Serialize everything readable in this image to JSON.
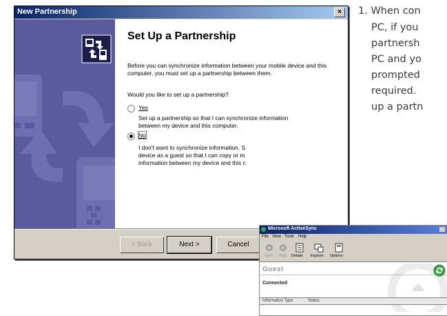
{
  "manual": {
    "lines": [
      "1. When con",
      "PC, if you",
      "partnersh",
      "PC and yo",
      "prompted",
      "required.",
      "up a partn"
    ]
  },
  "wizard": {
    "title": "New Partnership",
    "close_glyph": "×",
    "heading": "Set Up a Partnership",
    "intro": "Before you can synchronize information between your mobile device and this computer, you must set up a partnership between them.",
    "question": "Would you like to set up a partnership?",
    "yes_label": "Yes",
    "yes_desc": "Set up a partnership so that I can synchronize information between my device and this computer.",
    "no_label": "No",
    "no_desc_1": "I don't want to synchronize information. S",
    "no_desc_2": "device as a guest so that I can copy or m",
    "no_desc_3": "information between my device and this c",
    "selected": "No",
    "back_label": "< Back",
    "next_label": "Next >",
    "cancel_label": "Cancel"
  },
  "activesync": {
    "title": "Microsoft ActiveSync",
    "menu": [
      "File",
      "View",
      "Tools",
      "Help"
    ],
    "toolbar": [
      "Sync",
      "Stop",
      "Details",
      "Explore",
      "Options"
    ],
    "device_name": "Guest",
    "status": "Connected",
    "col_info_type": "Information Type",
    "col_status": "Status"
  },
  "colors": {
    "banner": "#5a5a9e",
    "title_bar": "#0a246a",
    "sync_green": "#3aa14a"
  }
}
